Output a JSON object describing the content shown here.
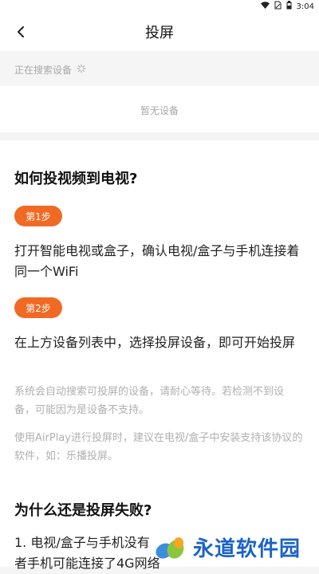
{
  "status_bar": {
    "time": "3:04",
    "icons": [
      "wifi-icon",
      "sim-icon",
      "battery-icon"
    ]
  },
  "header": {
    "title": "投屏",
    "back_icon": "chevron-left-icon"
  },
  "search": {
    "label": "正在搜索设备",
    "spinner_icon": "loading-icon"
  },
  "device_list": {
    "empty_text": "暂无设备"
  },
  "help": {
    "heading": "如何投视频到电视?",
    "steps": [
      {
        "badge": "第1步",
        "text": "打开智能电视或盒子，确认电视/盒子与手机连接着同一个WiFi"
      },
      {
        "badge": "第2步",
        "text": "在上方设备列表中，选择投屏设备，即可开始投屏"
      }
    ],
    "notes": [
      "系统会自动搜索可投屏的设备，请耐心等待。若检测不到设备，可能因为是设备不支持。",
      "使用AirPlay进行投屏时，建议在电视/盒子中安装支持该协议的软件，如：乐播投屏。"
    ]
  },
  "failure": {
    "heading": "为什么还是投屏失败?",
    "item1_line1": "1. 电视/盒子与手机没有",
    "item1_line2": "者手机可能连接了4G网络"
  },
  "watermark": {
    "text": "永道软件园"
  },
  "colors": {
    "accent": "#f16a24",
    "watermark_blue": "#1b63c7"
  }
}
